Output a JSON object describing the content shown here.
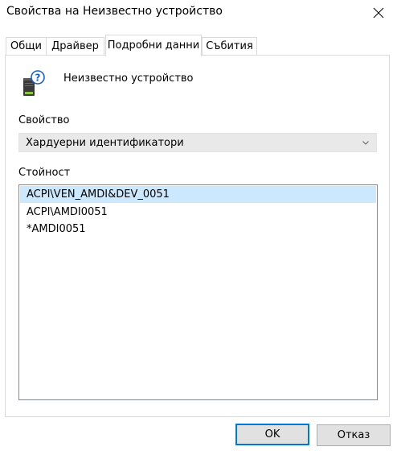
{
  "window": {
    "title": "Свойства на Неизвестно устройство"
  },
  "tabs": [
    {
      "label": "Общи",
      "active": false
    },
    {
      "label": "Драйвер",
      "active": false
    },
    {
      "label": "Подробни данни",
      "active": true
    },
    {
      "label": "Събития",
      "active": false
    }
  ],
  "device": {
    "icon": "unknown-device-icon",
    "name": "Неизвестно устройство"
  },
  "property": {
    "label": "Свойство",
    "selected": "Хардуерни идентификатори"
  },
  "value_list": {
    "label": "Стойност",
    "items": [
      "ACPI\\VEN_AMDI&DEV_0051",
      "ACPI\\AMDI0051",
      "*AMDI0051"
    ],
    "selected_index": 0
  },
  "buttons": {
    "ok": "OK",
    "cancel": "Отказ"
  },
  "colors": {
    "selection": "#cce8ff",
    "default_button_border": "#0078d7"
  }
}
